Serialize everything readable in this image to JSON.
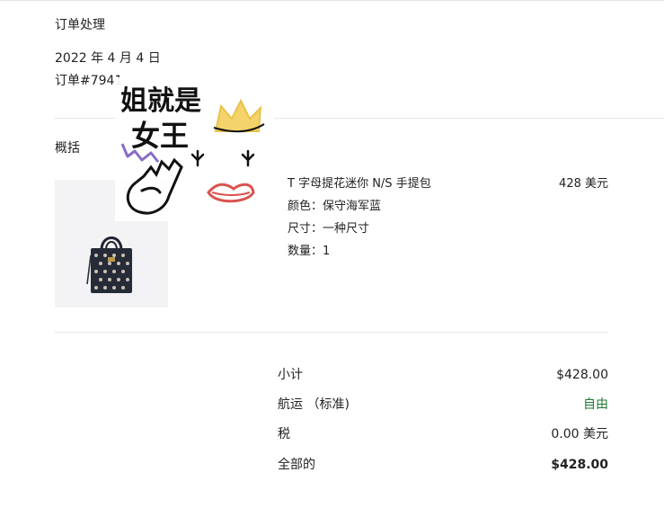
{
  "header": {
    "section_title": "订单处理",
    "date": "2022 年 4 月 4 日",
    "order_number": "订单#7941"
  },
  "summary": {
    "heading": "概括",
    "item": {
      "name": "T 字母提花迷你 N/S 手提包",
      "price": "428 美元",
      "color": "颜色：保守海军蓝",
      "size": "尺寸：一种尺寸",
      "quantity": "数量：1",
      "image_icon": "tote-bag-icon"
    }
  },
  "totals": {
    "rows": [
      {
        "label": "小计",
        "value": "$428.00"
      },
      {
        "label": "航运 （标准)",
        "value": "自由"
      },
      {
        "label": "税",
        "value": "0.00 美元"
      },
      {
        "label": "全部的",
        "value": "$428.00"
      }
    ]
  },
  "sticker": {
    "text_line1": "姐就是",
    "text_line2": "女王",
    "icons": [
      "crown-icon",
      "lips-icon",
      "rock-hand-icon",
      "eyelashes-icon",
      "bat-doodle-icon"
    ],
    "colors": {
      "crown": "#e9c24a",
      "lips": "#d9534f",
      "bat": "#8a6cc4",
      "ink": "#111111"
    }
  },
  "colors": {
    "free_green": "#1e7a2e",
    "divider": "#e6e6e6",
    "photo_bg": "#f3f3f5"
  }
}
